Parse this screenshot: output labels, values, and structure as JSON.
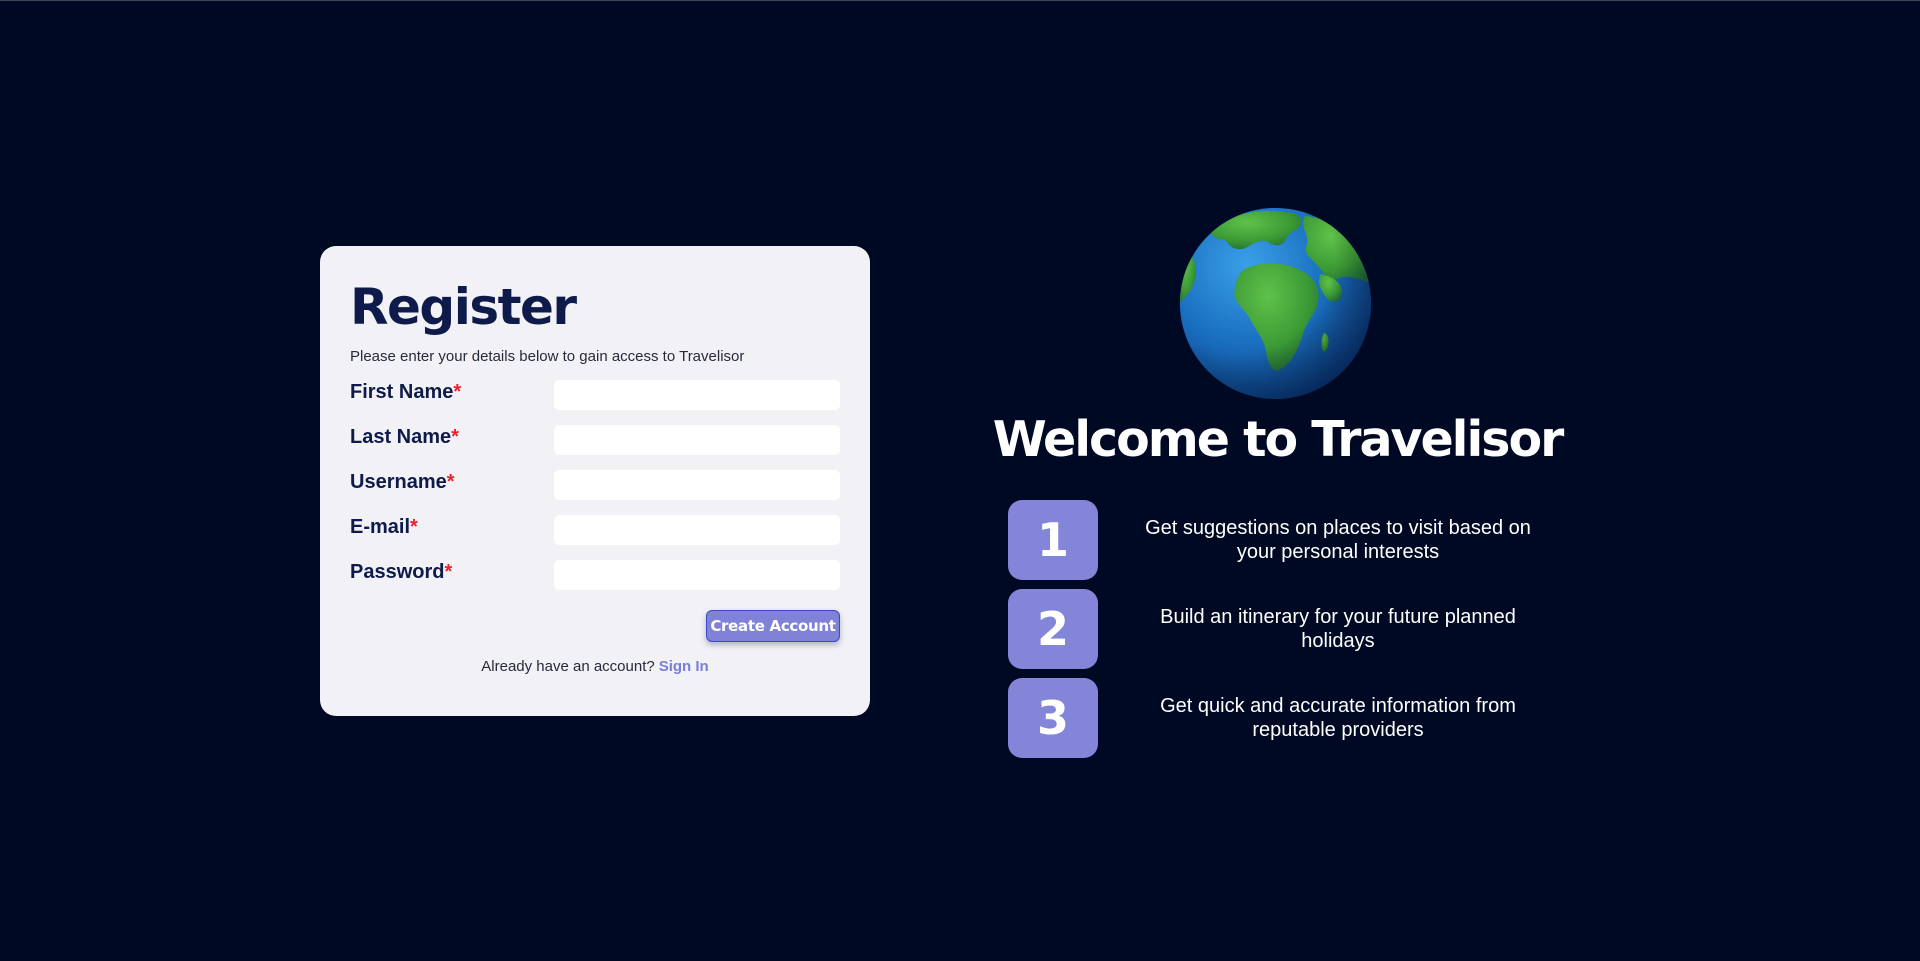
{
  "register": {
    "title": "Register",
    "subtitle": "Please enter your details below to gain access to Travelisor",
    "required_mark": "*",
    "fields": [
      {
        "label": "First Name",
        "value": ""
      },
      {
        "label": "Last Name",
        "value": ""
      },
      {
        "label": "Username",
        "value": ""
      },
      {
        "label": "E-mail",
        "value": ""
      },
      {
        "label": "Password",
        "value": ""
      }
    ],
    "submit_label": "Create Account",
    "signin_prompt": "Already have an account?",
    "signin_link": "Sign In"
  },
  "welcome": {
    "icon": "globe-icon",
    "title": "Welcome to Travelisor",
    "features": [
      {
        "number": "1",
        "text": "Get suggestions on places to visit based on your personal interests"
      },
      {
        "number": "2",
        "text": "Build an itinerary for your future planned holidays"
      },
      {
        "number": "3",
        "text": "Get quick and accurate information from reputable providers"
      }
    ]
  },
  "colors": {
    "background": "#000923",
    "card": "#f1f1f6",
    "heading": "#0e1a4a",
    "accent": "#7f82d6",
    "required": "#e8222c",
    "link": "#7b7fd4"
  }
}
